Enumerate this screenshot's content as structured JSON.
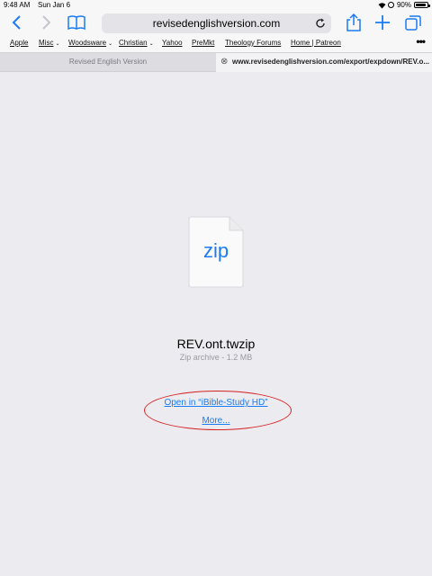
{
  "status_bar": {
    "time": "9:48 AM",
    "date": "Sun Jan 6",
    "battery": "90%",
    "battery_level": 0.9
  },
  "toolbar": {
    "url": "revisedenglishversion.com",
    "icons": [
      "back-icon",
      "forward-icon",
      "bookmarks-icon",
      "reload-icon",
      "share-icon",
      "new-tab-icon",
      "tabs-icon"
    ]
  },
  "bookmarks": [
    {
      "label": "Apple"
    },
    {
      "label": "Misc",
      "chevron": "⌄"
    },
    {
      "label": "Woodsware",
      "chevron": "⌄"
    },
    {
      "label": "Christian",
      "chevron": "⌄"
    },
    {
      "label": "Yahoo"
    },
    {
      "label": "PreMkt"
    },
    {
      "label": "Theology Forums"
    },
    {
      "label": "Home | Patreon"
    }
  ],
  "bookmarks_more": "•••",
  "tabs": [
    {
      "label": "Revised English Version",
      "active": false
    },
    {
      "label": "www.revisedenglishversion.com/export/expdown/REV.o...",
      "active": true,
      "close": "⊗"
    }
  ],
  "download": {
    "file_ext": "zip",
    "file_name": "REV.ont.twzip",
    "file_meta": "Zip archive - 1.2 MB",
    "open_in": "Open in “iBible-Study HD”",
    "more": "More..."
  },
  "colors": {
    "accent": "#1a7cf4",
    "background": "#ebebf0",
    "annotation": "#d62020"
  }
}
